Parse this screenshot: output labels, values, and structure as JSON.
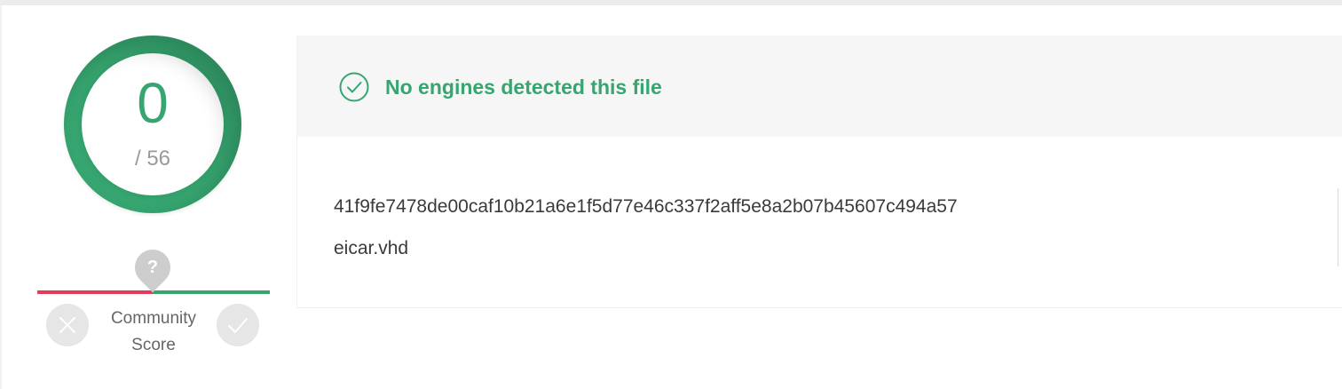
{
  "score": {
    "positives": "0",
    "total": "/ 56",
    "ring_color": "#36a56f"
  },
  "community": {
    "label_line1": "Community",
    "label_line2": "Score",
    "marker_glyph": "?",
    "marker_icon": "question-icon",
    "negative_color": "#e53b5a",
    "positive_color": "#36a56f",
    "vote_down_icon": "close-icon",
    "vote_up_icon": "check-icon"
  },
  "detection": {
    "message": "No engines detected this file",
    "icon": "check-circle-icon",
    "color": "#36a56f"
  },
  "file": {
    "hash": "41f9fe7478de00caf10b21a6e1f5d77e46c337f2aff5e8a2b07b45607c494a57",
    "name": "eicar.vhd"
  }
}
